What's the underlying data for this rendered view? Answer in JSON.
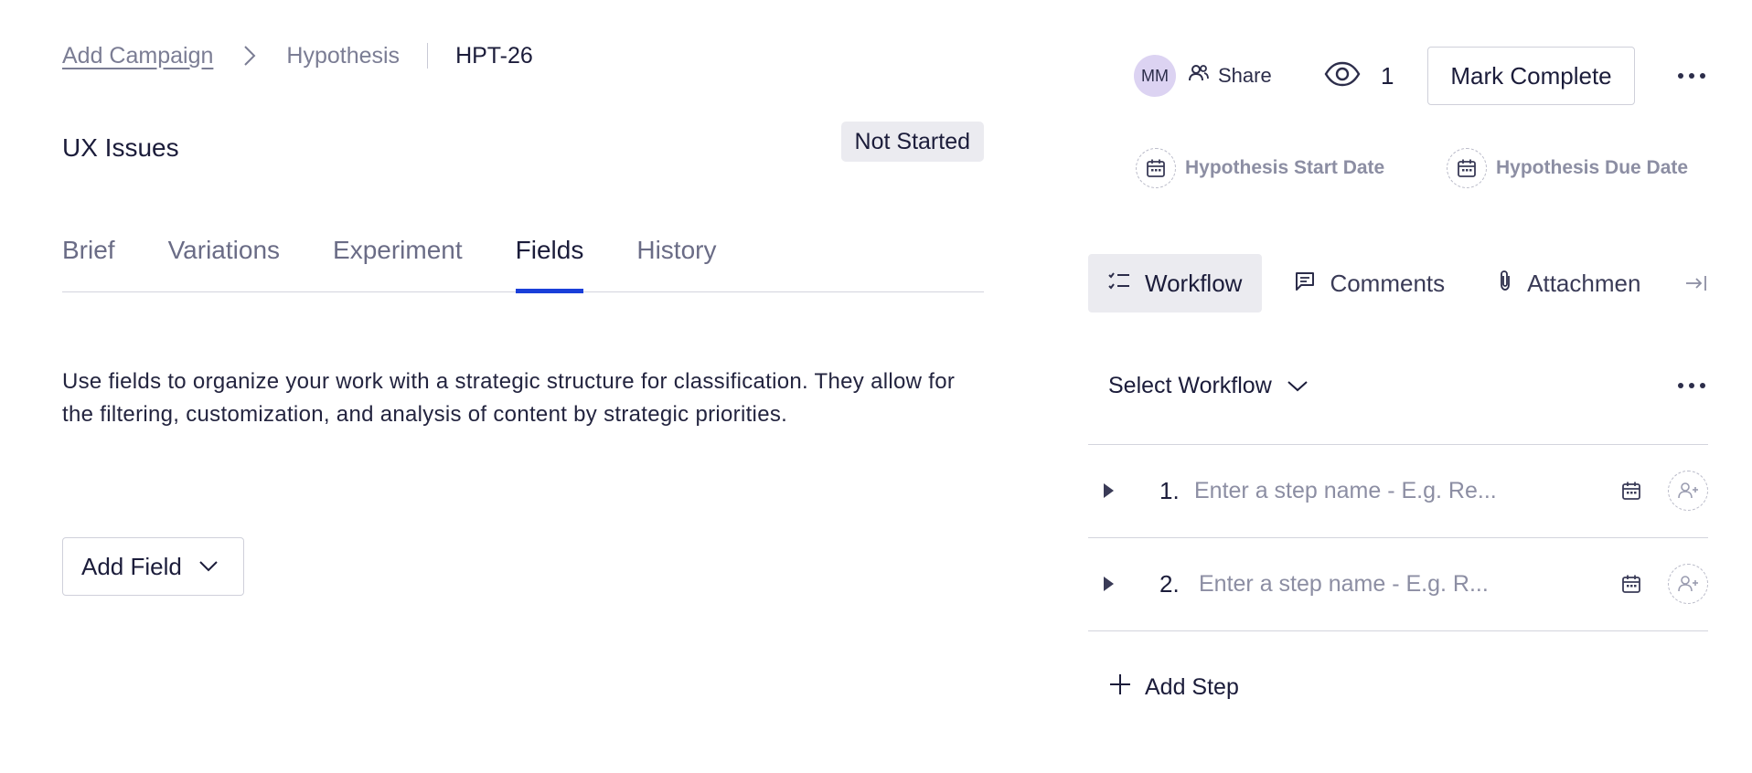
{
  "breadcrumb": {
    "link": "Add Campaign",
    "middle": "Hypothesis",
    "current": "HPT-26"
  },
  "page": {
    "title": "UX Issues",
    "status": "Not Started"
  },
  "tabs": [
    {
      "label": "Brief"
    },
    {
      "label": "Variations"
    },
    {
      "label": "Experiment"
    },
    {
      "label": "Fields",
      "active": true
    },
    {
      "label": "History"
    }
  ],
  "fields": {
    "description": "Use fields to organize your work with a strategic structure for classification. They allow for the filtering, customization, and analysis of content by strategic priorities.",
    "add_field_label": "Add Field"
  },
  "header": {
    "avatar_initials": "MM",
    "share_label": "Share",
    "watchers_count": "1",
    "mark_complete_label": "Mark Complete"
  },
  "dates": {
    "start_label": "Hypothesis Start Date",
    "due_label": "Hypothesis Due Date"
  },
  "side_tabs": [
    {
      "label": "Workflow",
      "active": true
    },
    {
      "label": "Comments"
    },
    {
      "label": "Attachmen"
    }
  ],
  "workflow": {
    "select_label": "Select Workflow",
    "steps": [
      {
        "number": "1.",
        "placeholder": "Enter a step name - E.g. Re..."
      },
      {
        "number": "2.",
        "placeholder": "Enter a step name - E.g. R..."
      }
    ],
    "add_step_label": "Add Step"
  },
  "colors": {
    "accent": "#1a3fd9",
    "text": "#1b1c3a",
    "muted": "#7b7d94",
    "badge_bg": "#ebebf0",
    "avatar_bg": "#dcd3f2"
  }
}
